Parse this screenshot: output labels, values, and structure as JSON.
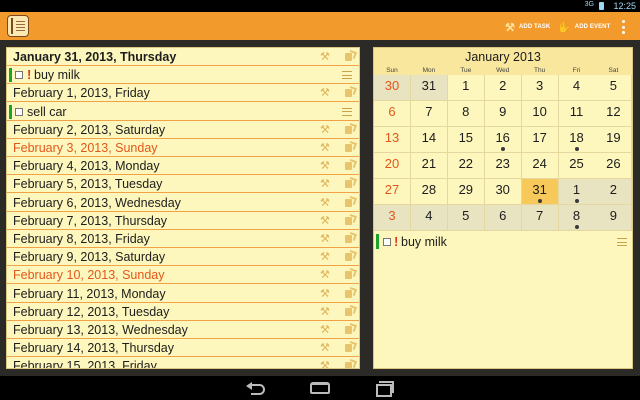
{
  "status_bar": {
    "signal": "3G",
    "clock": "12:25"
  },
  "action_bar": {
    "add_task_label": "ADD TASK",
    "add_event_label": "ADD EVENT",
    "accent_color": "#f39a2d"
  },
  "agenda": {
    "rows": [
      {
        "type": "date",
        "text": "January 31, 2013, Thursday",
        "bold": true,
        "sunday": false
      },
      {
        "type": "task",
        "text": "buy milk",
        "priority": true
      },
      {
        "type": "date",
        "text": "February 1, 2013, Friday",
        "bold": false,
        "sunday": false
      },
      {
        "type": "task",
        "text": "sell car",
        "priority": false
      },
      {
        "type": "date",
        "text": "February 2, 2013, Saturday",
        "bold": false,
        "sunday": false
      },
      {
        "type": "date",
        "text": "February 3, 2013, Sunday",
        "bold": false,
        "sunday": true
      },
      {
        "type": "date",
        "text": "February 4, 2013, Monday",
        "bold": false,
        "sunday": false
      },
      {
        "type": "date",
        "text": "February 5, 2013, Tuesday",
        "bold": false,
        "sunday": false
      },
      {
        "type": "date",
        "text": "February 6, 2013, Wednesday",
        "bold": false,
        "sunday": false
      },
      {
        "type": "date",
        "text": "February 7, 2013, Thursday",
        "bold": false,
        "sunday": false
      },
      {
        "type": "date",
        "text": "February 8, 2013, Friday",
        "bold": false,
        "sunday": false
      },
      {
        "type": "date",
        "text": "February 9, 2013, Saturday",
        "bold": false,
        "sunday": false
      },
      {
        "type": "date",
        "text": "February 10, 2013, Sunday",
        "bold": false,
        "sunday": true
      },
      {
        "type": "date",
        "text": "February 11, 2013, Monday",
        "bold": false,
        "sunday": false
      },
      {
        "type": "date",
        "text": "February 12, 2013, Tuesday",
        "bold": false,
        "sunday": false
      },
      {
        "type": "date",
        "text": "February 13, 2013, Wednesday",
        "bold": false,
        "sunday": false
      },
      {
        "type": "date",
        "text": "February 14, 2013, Thursday",
        "bold": false,
        "sunday": false
      },
      {
        "type": "date",
        "text": "February 15, 2013, Friday",
        "bold": false,
        "sunday": false
      }
    ],
    "icons": {
      "add_task_row": "hammer-icon",
      "add_event_row": "hand-icon"
    },
    "sunday_color": "#e2571a",
    "divider_color": "#f1a246"
  },
  "calendar": {
    "title": "January 2013",
    "weekdays": [
      "Sun",
      "Mon",
      "Tue",
      "Wed",
      "Thu",
      "Fri",
      "Sat"
    ],
    "weeks": [
      [
        {
          "day": "30",
          "other": true,
          "dot": false
        },
        {
          "day": "31",
          "other": true,
          "dot": false
        },
        {
          "day": "1",
          "other": false,
          "dot": false
        },
        {
          "day": "2",
          "other": false,
          "dot": false
        },
        {
          "day": "3",
          "other": false,
          "dot": false
        },
        {
          "day": "4",
          "other": false,
          "dot": false
        },
        {
          "day": "5",
          "other": false,
          "dot": false
        }
      ],
      [
        {
          "day": "6",
          "other": false,
          "dot": false
        },
        {
          "day": "7",
          "other": false,
          "dot": false
        },
        {
          "day": "8",
          "other": false,
          "dot": false
        },
        {
          "day": "9",
          "other": false,
          "dot": false
        },
        {
          "day": "10",
          "other": false,
          "dot": false
        },
        {
          "day": "11",
          "other": false,
          "dot": false
        },
        {
          "day": "12",
          "other": false,
          "dot": false
        }
      ],
      [
        {
          "day": "13",
          "other": false,
          "dot": false
        },
        {
          "day": "14",
          "other": false,
          "dot": false
        },
        {
          "day": "15",
          "other": false,
          "dot": false
        },
        {
          "day": "16",
          "other": false,
          "dot": true
        },
        {
          "day": "17",
          "other": false,
          "dot": false
        },
        {
          "day": "18",
          "other": false,
          "dot": true
        },
        {
          "day": "19",
          "other": false,
          "dot": false
        }
      ],
      [
        {
          "day": "20",
          "other": false,
          "dot": false
        },
        {
          "day": "21",
          "other": false,
          "dot": false
        },
        {
          "day": "22",
          "other": false,
          "dot": false
        },
        {
          "day": "23",
          "other": false,
          "dot": false
        },
        {
          "day": "24",
          "other": false,
          "dot": false
        },
        {
          "day": "25",
          "other": false,
          "dot": false
        },
        {
          "day": "26",
          "other": false,
          "dot": false
        }
      ],
      [
        {
          "day": "27",
          "other": false,
          "dot": false
        },
        {
          "day": "28",
          "other": false,
          "dot": false
        },
        {
          "day": "29",
          "other": false,
          "dot": false
        },
        {
          "day": "30",
          "other": false,
          "dot": false
        },
        {
          "day": "31",
          "other": false,
          "dot": true,
          "today": true
        },
        {
          "day": "1",
          "other": true,
          "dot": true
        },
        {
          "day": "2",
          "other": true,
          "dot": false
        }
      ],
      [
        {
          "day": "3",
          "other": true,
          "dot": false
        },
        {
          "day": "4",
          "other": true,
          "dot": false
        },
        {
          "day": "5",
          "other": true,
          "dot": false
        },
        {
          "day": "6",
          "other": true,
          "dot": false
        },
        {
          "day": "7",
          "other": true,
          "dot": false
        },
        {
          "day": "8",
          "other": true,
          "dot": true
        },
        {
          "day": "9",
          "other": true,
          "dot": false
        }
      ]
    ],
    "selected_day_task": {
      "text": "buy milk",
      "priority": true
    },
    "today_color": "#f7c85a"
  },
  "nav_bar": {
    "icons": [
      "back-icon",
      "home-icon",
      "recents-icon"
    ]
  }
}
